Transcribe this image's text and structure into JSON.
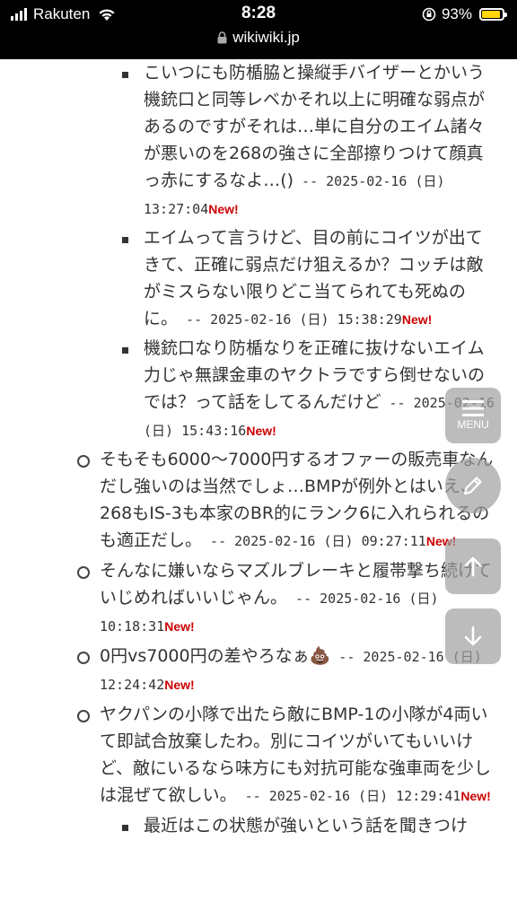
{
  "status_bar": {
    "carrier": "Rakuten",
    "time": "8:28",
    "battery": "93%",
    "battery_level": 0.93,
    "url": "wikiwiki.jp"
  },
  "comments": [
    {
      "level": 3,
      "text": "こいつにも防楯脇と操縦手バイザーとかいう機銃口と同等レベかそれ以上に明確な弱点があるのですがそれは…単に自分のエイム諸々が悪いのを268の強さに全部擦りつけて顔真っ赤にするなよ…()",
      "date": " -- 2025-02-16 (日) 13:27:04",
      "new": "New!"
    },
    {
      "level": 3,
      "text": "エイムって言うけど、目の前にコイツが出てきて、正確に弱点だけ狙えるか？コッチは敵がミスらない限りどこ当てられても死ぬのに。",
      "date": " -- 2025-02-16 (日) 15:38:29",
      "new": "New!"
    },
    {
      "level": 3,
      "text": "機銃口なり防楯なりを正確に抜けないエイム力じゃ無課金車のヤクトラですら倒せないのでは？って話をしてるんだけど",
      "date": " -- 2025-02-16 (日) 15:43:16",
      "new": "New!"
    },
    {
      "level": 2,
      "text": "そもそも6000～7000円するオファーの販売車なんだし強いのは当然でしょ…BMPが例外とはいえ、268もIS-3も本家のBR的にランク6に入れられるのも適正だし。",
      "date": " -- 2025-02-16 (日) 09:27:11",
      "new": "New!"
    },
    {
      "level": 2,
      "text": "そんなに嫌いならマズルブレーキと履帯撃ち続けていじめればいいじゃん。",
      "date": " -- 2025-02-16 (日) 10:18:31",
      "new": "New!"
    },
    {
      "level": 2,
      "text": "0円vs7000円の差やろなぁ",
      "emoji": "💩",
      "date": " -- 2025-02-16 (日) 12:24:42",
      "new": "New!"
    },
    {
      "level": 2,
      "text": "ヤクパンの小隊で出たら敵にBMP-1の小隊が4両いて即試合放棄したわ。別にコイツがいてもいいけど、敵にいるなら味方にも対抗可能な強車両を少しは混ぜて欲しい。",
      "date": " -- 2025-02-16 (日) 12:29:41",
      "new": "New!"
    },
    {
      "level": 3,
      "text": "最近はこの状態が強いという話を聞きつけ",
      "date": "",
      "new": ""
    }
  ],
  "buttons": {
    "menu_label": "MENU",
    "menu_icon": "hamburger-icon",
    "edit_icon": "pencil-icon",
    "up_icon": "arrow-up-icon",
    "down_icon": "arrow-down-icon"
  }
}
